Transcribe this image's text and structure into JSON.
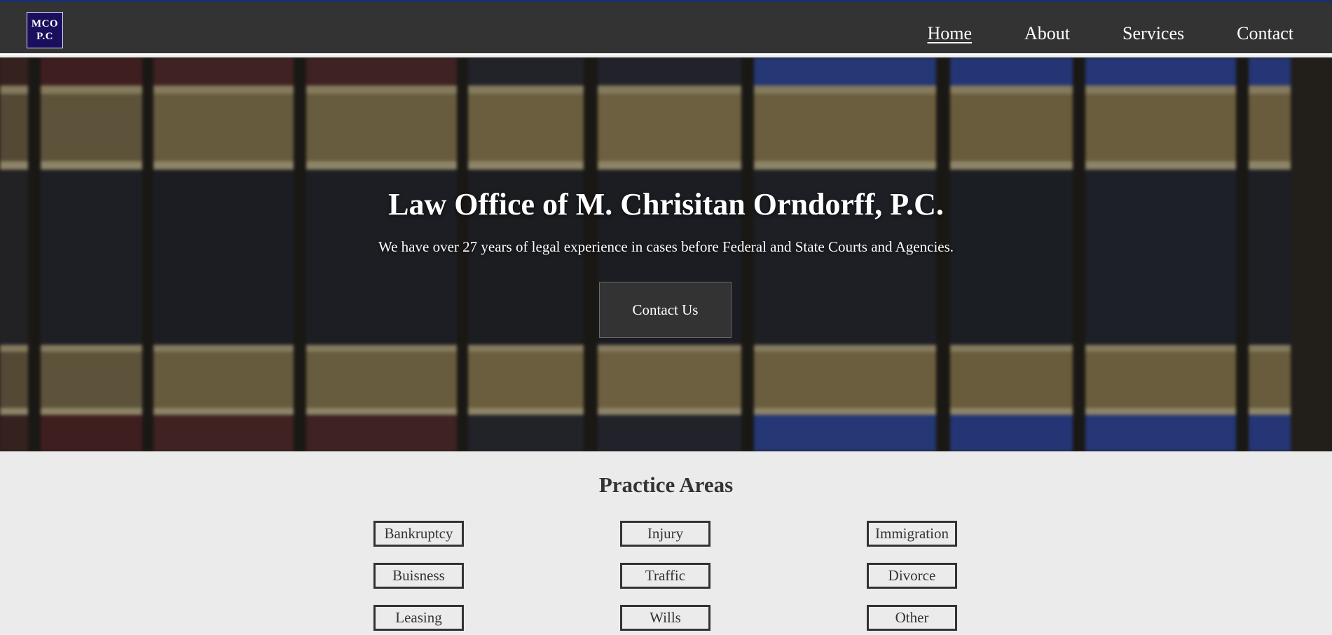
{
  "header": {
    "logo": {
      "line1": "MCO",
      "line2": "P.C"
    },
    "nav": [
      {
        "label": "Home",
        "active": true
      },
      {
        "label": "About",
        "active": false
      },
      {
        "label": "Services",
        "active": false
      },
      {
        "label": "Contact",
        "active": false
      }
    ]
  },
  "hero": {
    "title": "Law Office of M. Chrisitan Orndorff, P.C.",
    "subtitle": "We have over 27 years of legal experience in cases before Federal and State Courts and Agencies.",
    "cta_label": "Contact Us"
  },
  "practice": {
    "title": "Practice Areas",
    "areas": [
      "Bankruptcy",
      "Injury",
      "Immigration",
      "Buisness",
      "Traffic",
      "Divorce",
      "Leasing",
      "Wills",
      "Other"
    ]
  },
  "colors": {
    "header_bg": "#333333",
    "accent_top": "#1c2e6e",
    "logo_bg": "#1a0f5c",
    "page_bg": "#ebebeb",
    "text_dark": "#333333"
  }
}
